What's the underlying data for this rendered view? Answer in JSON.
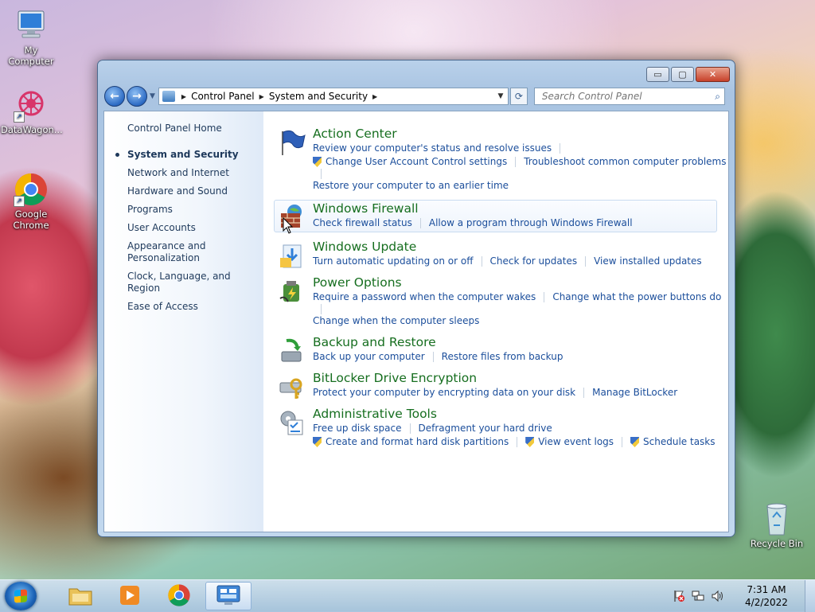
{
  "desktop": {
    "icons": [
      {
        "label": "My Computer"
      },
      {
        "label": "DataWagon..."
      },
      {
        "label": "Google Chrome"
      },
      {
        "label": "Recycle Bin"
      }
    ]
  },
  "window": {
    "controls": {
      "minimize": "▭",
      "maximize": "▢",
      "close": "✕"
    },
    "address": {
      "segments": [
        "Control Panel",
        "System and Security"
      ]
    },
    "search": {
      "placeholder": "Search Control Panel"
    }
  },
  "sidebar": {
    "home": "Control Panel Home",
    "items": [
      {
        "label": "System and Security",
        "current": true
      },
      {
        "label": "Network and Internet"
      },
      {
        "label": "Hardware and Sound"
      },
      {
        "label": "Programs"
      },
      {
        "label": "User Accounts"
      },
      {
        "label": "Appearance and Personalization"
      },
      {
        "label": "Clock, Language, and Region"
      },
      {
        "label": "Ease of Access"
      }
    ]
  },
  "categories": [
    {
      "title": "Action Center",
      "icon": "flag-icon",
      "links": [
        {
          "label": "Review your computer's status and resolve issues"
        },
        {
          "label": "Change User Account Control settings",
          "shield": true
        },
        {
          "label": "Troubleshoot common computer problems"
        },
        {
          "label": "Restore your computer to an earlier time"
        }
      ]
    },
    {
      "title": "Windows Firewall",
      "icon": "firewall-icon",
      "links": [
        {
          "label": "Check firewall status"
        },
        {
          "label": "Allow a program through Windows Firewall"
        }
      ]
    },
    {
      "title": "Windows Update",
      "icon": "update-icon",
      "links": [
        {
          "label": "Turn automatic updating on or off"
        },
        {
          "label": "Check for updates"
        },
        {
          "label": "View installed updates"
        }
      ]
    },
    {
      "title": "Power Options",
      "icon": "power-icon",
      "links": [
        {
          "label": "Require a password when the computer wakes"
        },
        {
          "label": "Change what the power buttons do"
        },
        {
          "label": "Change when the computer sleeps"
        }
      ]
    },
    {
      "title": "Backup and Restore",
      "icon": "backup-icon",
      "links": [
        {
          "label": "Back up your computer"
        },
        {
          "label": "Restore files from backup"
        }
      ]
    },
    {
      "title": "BitLocker Drive Encryption",
      "icon": "bitlocker-icon",
      "links": [
        {
          "label": "Protect your computer by encrypting data on your disk"
        },
        {
          "label": "Manage BitLocker"
        }
      ]
    },
    {
      "title": "Administrative Tools",
      "icon": "admin-tools-icon",
      "links": [
        {
          "label": "Free up disk space"
        },
        {
          "label": "Defragment your hard drive"
        },
        {
          "label": "Create and format hard disk partitions",
          "shield": true
        },
        {
          "label": "View event logs",
          "shield": true
        },
        {
          "label": "Schedule tasks",
          "shield": true
        }
      ]
    }
  ],
  "taskbar": {
    "clock_time": "7:31 AM",
    "clock_date": "4/2/2022"
  },
  "colors": {
    "link": "#1b4e9b",
    "category_title": "#166e1f",
    "sidebar_text": "#1e395b"
  }
}
